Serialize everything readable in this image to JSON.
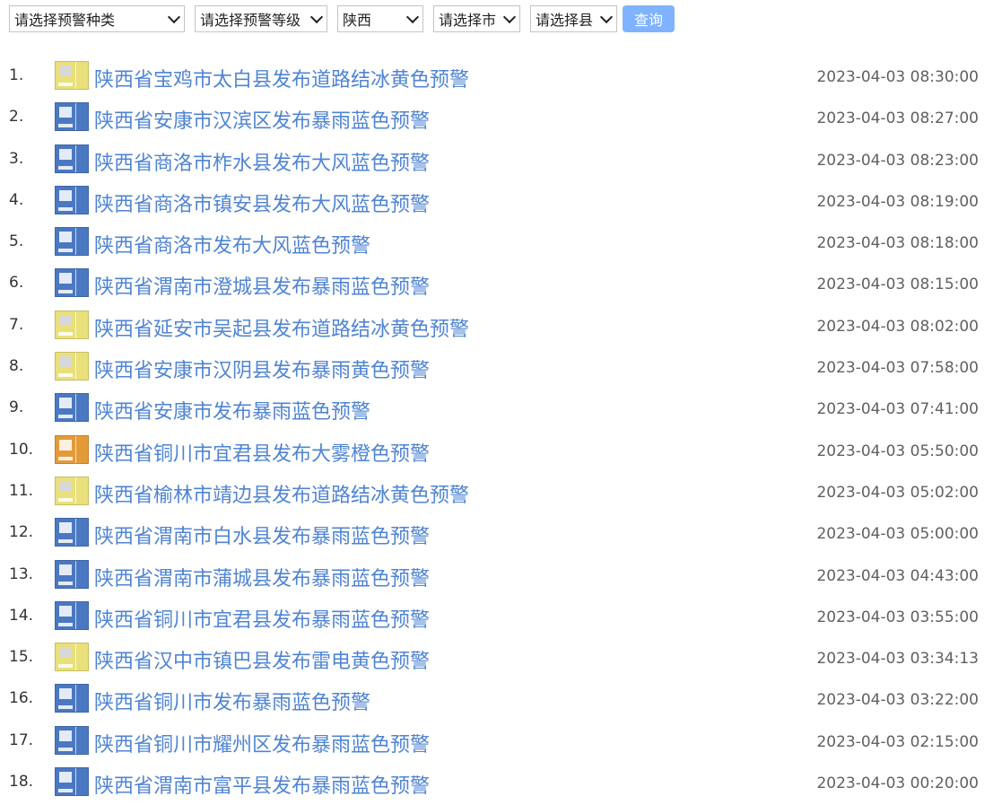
{
  "filters": {
    "type_select": "请选择预警种类",
    "level_select": "请选择预警等级",
    "province_select": "陕西",
    "city_select": "请选择市",
    "county_select": "请选择县",
    "query_button": "查询"
  },
  "colors": {
    "link": "#4f84d4",
    "button": "#7fb3ff",
    "yellow_icon": "#e9e07a",
    "blue_icon": "#4a78c2",
    "orange_icon": "#e59a3a"
  },
  "alerts": [
    {
      "num": "1.",
      "title": "陕西省宝鸡市太白县发布道路结冰黄色预警",
      "time": "2023-04-03 08:30:00",
      "icon": "road-icing-yellow-icon"
    },
    {
      "num": "2.",
      "title": "陕西省安康市汉滨区发布暴雨蓝色预警",
      "time": "2023-04-03 08:27:00",
      "icon": "rainstorm-blue-icon"
    },
    {
      "num": "3.",
      "title": "陕西省商洛市柞水县发布大风蓝色预警",
      "time": "2023-04-03 08:23:00",
      "icon": "gale-blue-icon"
    },
    {
      "num": "4.",
      "title": "陕西省商洛市镇安县发布大风蓝色预警",
      "time": "2023-04-03 08:19:00",
      "icon": "gale-blue-icon"
    },
    {
      "num": "5.",
      "title": "陕西省商洛市发布大风蓝色预警",
      "time": "2023-04-03 08:18:00",
      "icon": "gale-blue-icon"
    },
    {
      "num": "6.",
      "title": "陕西省渭南市澄城县发布暴雨蓝色预警",
      "time": "2023-04-03 08:15:00",
      "icon": "rainstorm-blue-icon"
    },
    {
      "num": "7.",
      "title": "陕西省延安市吴起县发布道路结冰黄色预警",
      "time": "2023-04-03 08:02:00",
      "icon": "road-icing-yellow-icon"
    },
    {
      "num": "8.",
      "title": "陕西省安康市汉阴县发布暴雨黄色预警",
      "time": "2023-04-03 07:58:00",
      "icon": "rainstorm-yellow-icon"
    },
    {
      "num": "9.",
      "title": "陕西省安康市发布暴雨蓝色预警",
      "time": "2023-04-03 07:41:00",
      "icon": "rainstorm-blue-icon"
    },
    {
      "num": "10.",
      "title": "陕西省铜川市宜君县发布大雾橙色预警",
      "time": "2023-04-03 05:50:00",
      "icon": "fog-orange-icon"
    },
    {
      "num": "11.",
      "title": "陕西省榆林市靖边县发布道路结冰黄色预警",
      "time": "2023-04-03 05:02:00",
      "icon": "road-icing-yellow-icon"
    },
    {
      "num": "12.",
      "title": "陕西省渭南市白水县发布暴雨蓝色预警",
      "time": "2023-04-03 05:00:00",
      "icon": "rainstorm-blue-icon"
    },
    {
      "num": "13.",
      "title": "陕西省渭南市蒲城县发布暴雨蓝色预警",
      "time": "2023-04-03 04:43:00",
      "icon": "rainstorm-blue-icon"
    },
    {
      "num": "14.",
      "title": "陕西省铜川市宜君县发布暴雨蓝色预警",
      "time": "2023-04-03 03:55:00",
      "icon": "rainstorm-blue-icon"
    },
    {
      "num": "15.",
      "title": "陕西省汉中市镇巴县发布雷电黄色预警",
      "time": "2023-04-03 03:34:13",
      "icon": "lightning-yellow-icon"
    },
    {
      "num": "16.",
      "title": "陕西省铜川市发布暴雨蓝色预警",
      "time": "2023-04-03 03:22:00",
      "icon": "rainstorm-blue-icon"
    },
    {
      "num": "17.",
      "title": "陕西省铜川市耀州区发布暴雨蓝色预警",
      "time": "2023-04-03 02:15:00",
      "icon": "rainstorm-blue-icon"
    },
    {
      "num": "18.",
      "title": "陕西省渭南市富平县发布暴雨蓝色预警",
      "time": "2023-04-03 00:20:00",
      "icon": "rainstorm-blue-icon"
    }
  ]
}
